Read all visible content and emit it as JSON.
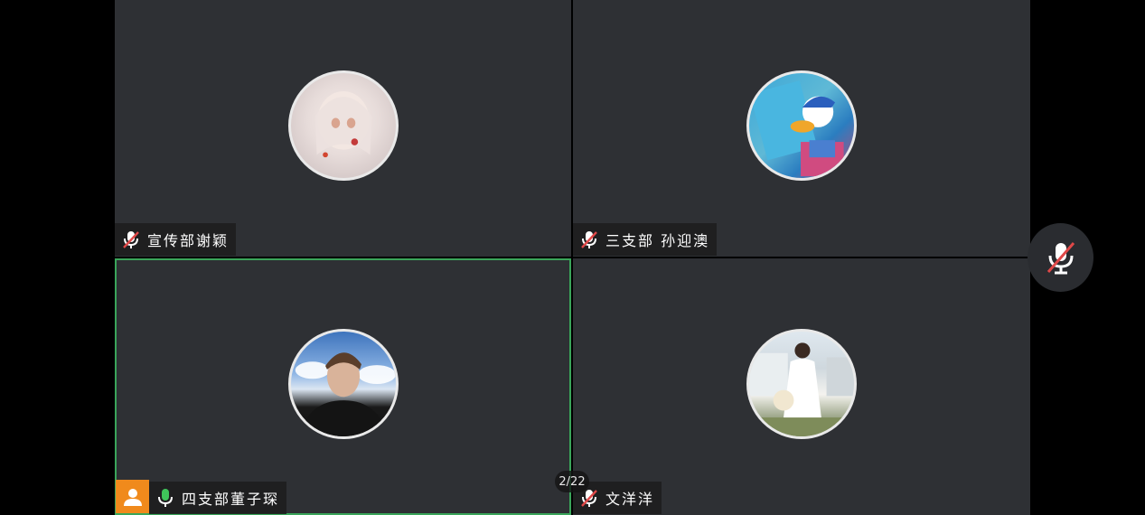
{
  "participants": [
    {
      "name": "宣传部谢颖",
      "mic_state": "muted",
      "avatar": "anime-girl-avatar"
    },
    {
      "name": "三支部 孙迎澳",
      "mic_state": "muted",
      "avatar": "cartoon-duck-avatar"
    },
    {
      "name": "四支部董子琛",
      "mic_state": "active",
      "avatar": "young-man-photo-avatar",
      "host": true
    },
    {
      "name": "文洋洋",
      "mic_state": "muted",
      "avatar": "woman-photo-avatar"
    }
  ],
  "page_indicator": "2/22",
  "colors": {
    "tile_bg": "#2e3034",
    "active_border": "#3aa55a",
    "host_badge": "#f08a1c",
    "mic_active": "#3fc45a",
    "mic_muted_slash": "#e04848"
  },
  "self_mic": {
    "state": "muted",
    "icon": "mic-muted-icon"
  }
}
